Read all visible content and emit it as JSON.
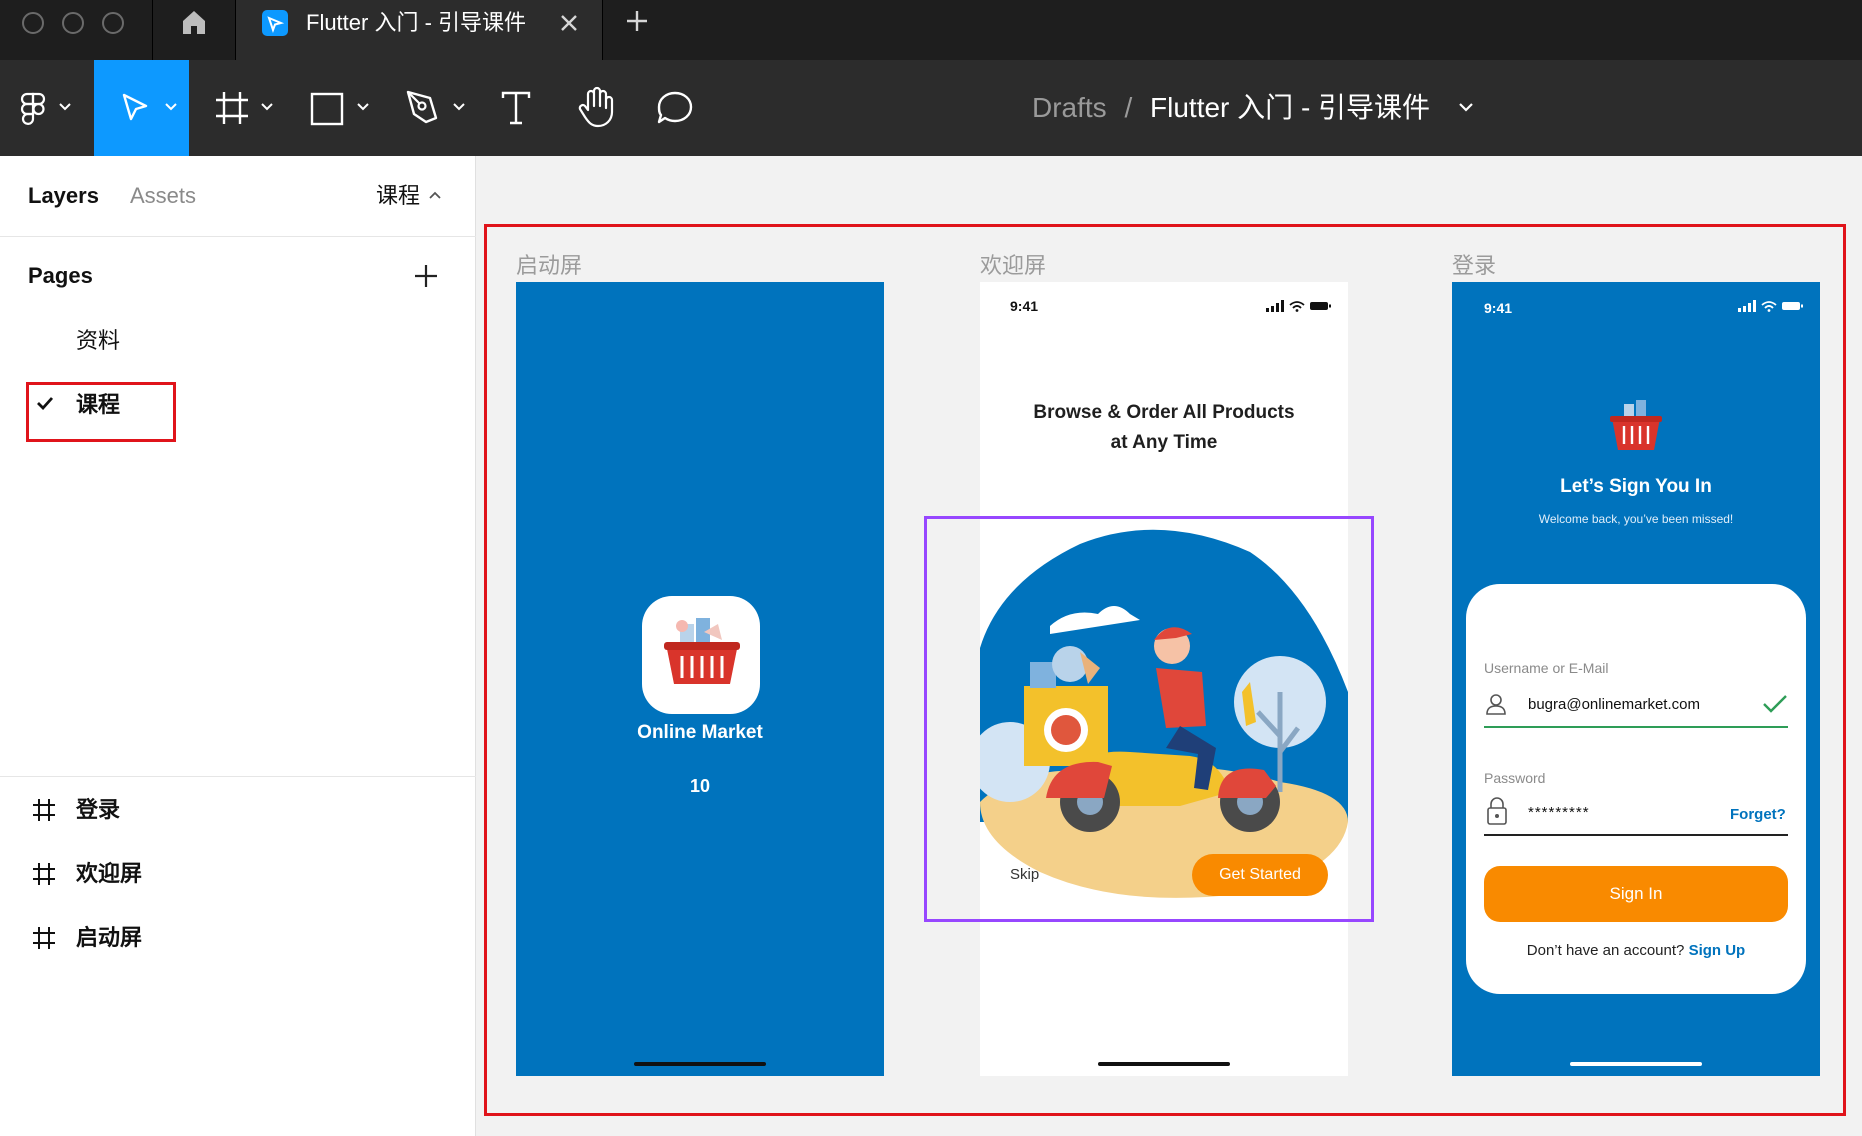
{
  "tab": {
    "title": "Flutter 入门 - 引导课件"
  },
  "toolbar": {
    "breadcrumb_root": "Drafts",
    "breadcrumb_sep": "/",
    "file_name": "Flutter 入门 - 引导课件"
  },
  "left_panel": {
    "tab_layers": "Layers",
    "tab_assets": "Assets",
    "current_page": "课程",
    "pages_heading": "Pages",
    "pages": [
      {
        "label": "资料",
        "selected": false
      },
      {
        "label": "课程",
        "selected": true
      }
    ],
    "layers": [
      {
        "label": "登录"
      },
      {
        "label": "欢迎屏"
      },
      {
        "label": "启动屏"
      }
    ]
  },
  "canvas": {
    "frames": [
      {
        "label": "启动屏"
      },
      {
        "label": "欢迎屏"
      },
      {
        "label": "登录"
      }
    ],
    "splash": {
      "title": "Online Market",
      "number": "10"
    },
    "welcome": {
      "time": "9:41",
      "headline_1": "Browse & Order All Products",
      "headline_2": "at Any Time",
      "skip": "Skip",
      "cta": "Get Started"
    },
    "login": {
      "time": "9:41",
      "title": "Let’s Sign You In",
      "subtitle": "Welcome back, you’ve been missed!",
      "username_label": "Username or E-Mail",
      "username_value": "bugra@onlinemarket.com",
      "password_label": "Password",
      "password_value": "*********",
      "forget": "Forget?",
      "sign_in": "Sign In",
      "no_account": "Don’t have an account?",
      "sign_up": "Sign Up"
    }
  },
  "colors": {
    "primary_blue": "#0073bd",
    "accent_orange": "#f98a00",
    "figma_blue": "#0d99ff",
    "highlight_red": "#e0141b",
    "selection_purple": "#9747ff"
  }
}
